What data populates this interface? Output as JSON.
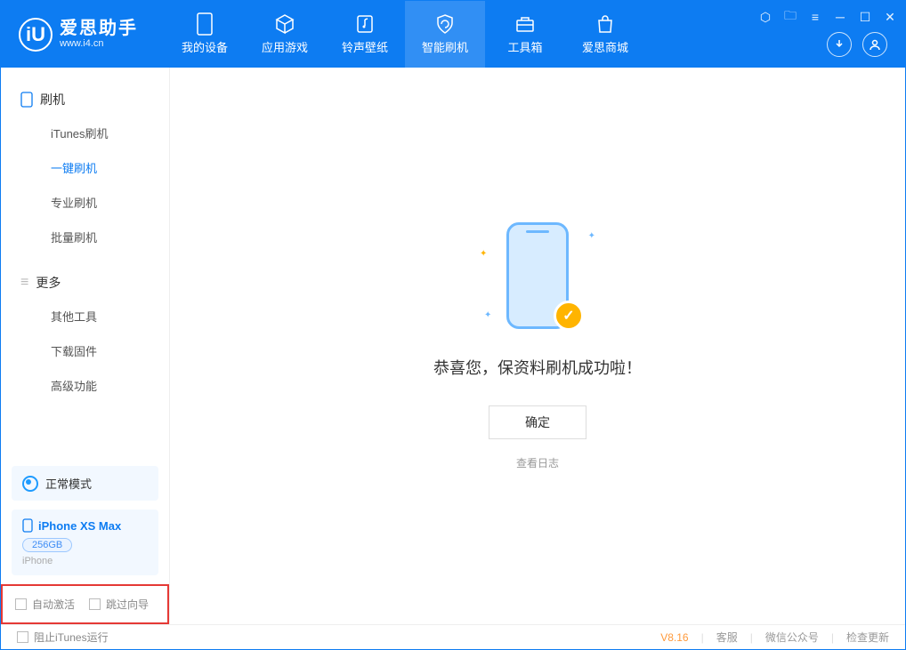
{
  "app": {
    "title": "爱思助手",
    "site": "www.i4.cn",
    "logo_letter": "iU"
  },
  "nav": [
    {
      "label": "我的设备"
    },
    {
      "label": "应用游戏"
    },
    {
      "label": "铃声壁纸"
    },
    {
      "label": "智能刷机"
    },
    {
      "label": "工具箱"
    },
    {
      "label": "爱思商城"
    }
  ],
  "sidebar": {
    "group1": "刷机",
    "items1": [
      "iTunes刷机",
      "一键刷机",
      "专业刷机",
      "批量刷机"
    ],
    "group2": "更多",
    "items2": [
      "其他工具",
      "下载固件",
      "高级功能"
    ]
  },
  "mode": {
    "label": "正常模式"
  },
  "device": {
    "name": "iPhone XS Max",
    "capacity": "256GB",
    "type": "iPhone"
  },
  "options": {
    "auto_activate": "自动激活",
    "skip_guide": "跳过向导"
  },
  "main": {
    "message": "恭喜您，保资料刷机成功啦！",
    "ok": "确定",
    "view_log": "查看日志"
  },
  "footer": {
    "block_itunes": "阻止iTunes运行",
    "version": "V8.16",
    "links": [
      "客服",
      "微信公众号",
      "检查更新"
    ]
  }
}
